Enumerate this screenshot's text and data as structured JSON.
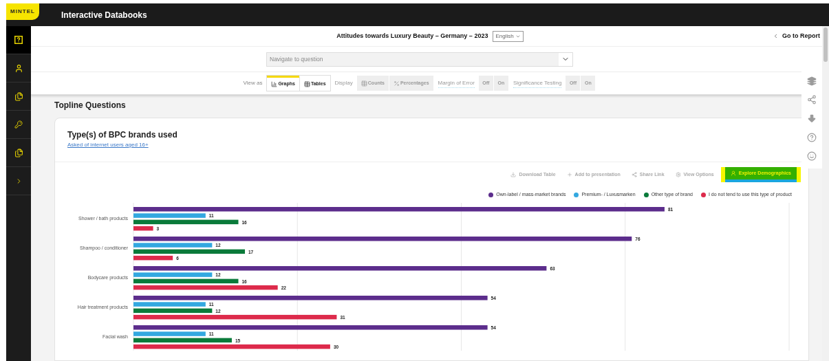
{
  "app": {
    "logo": "MINTEL",
    "title": "Interactive Databooks"
  },
  "sidebar": {
    "items": [
      {
        "kind": "help",
        "selected": true
      },
      {
        "kind": "person",
        "selected": false
      },
      {
        "kind": "files",
        "selected": false
      },
      {
        "kind": "key",
        "selected": false
      },
      {
        "kind": "files",
        "selected": false
      },
      {
        "kind": "expand",
        "selected": false
      }
    ]
  },
  "header": {
    "title": "Attitudes towards Luxury Beauty – Germany – 2023",
    "language": "English",
    "back_link": "Go to Report"
  },
  "navigate": {
    "placeholder": "Navigate to question"
  },
  "toolbar": {
    "view_as_label": "View as",
    "view_tabs": [
      {
        "label": "Graphs",
        "kind": "graphs",
        "selected": true
      },
      {
        "label": "Tables",
        "kind": "tables",
        "selected": false
      }
    ],
    "display": {
      "label": "Display",
      "disabled": true,
      "options": [
        {
          "label": "Counts",
          "kind": "counts"
        },
        {
          "label": "Percentages",
          "kind": "percent"
        }
      ]
    },
    "toggles": [
      {
        "label": "Margin of Error",
        "disabled": true,
        "options": [
          "Off",
          "On"
        ]
      },
      {
        "label": "Significance Testing",
        "disabled": true,
        "options": [
          "Off",
          "On"
        ]
      }
    ]
  },
  "section_title": "Topline Questions",
  "card": {
    "title": "Type(s) of BPC brands used",
    "subtitle_link": "Asked of internet users aged 16+",
    "actions": [
      {
        "label": "Download Table",
        "kind": "download",
        "highlighted": false
      },
      {
        "label": "Add to presentation",
        "kind": "add",
        "highlighted": false
      },
      {
        "label": "Share Link",
        "kind": "share",
        "highlighted": false
      },
      {
        "label": "View Options",
        "kind": "settings",
        "highlighted": false
      },
      {
        "label": "Explore Demographics",
        "kind": "explore",
        "highlighted": true
      }
    ],
    "chart_data": {
      "type": "bar",
      "orientation": "horizontal",
      "categories": [
        "Shower / bath products",
        "Shampoo / conditioner",
        "Bodycare products",
        "Hair treatment products",
        "Facial wash"
      ],
      "xlim": [
        0,
        100
      ],
      "data_labels": true,
      "series": [
        {
          "name": "Own-label / mass-market brands",
          "color": "#5c2d8c",
          "values": [
            81,
            76,
            63,
            54,
            54
          ]
        },
        {
          "name": "Premium- / Luxusmarken",
          "color": "#33a8e0",
          "values": [
            11,
            12,
            12,
            11,
            11
          ]
        },
        {
          "name": "Other type of brand",
          "color": "#0a7a3a",
          "values": [
            16,
            17,
            16,
            12,
            15
          ]
        },
        {
          "name": "I do not tend to use this type of product",
          "color": "#dd2a4b",
          "values": [
            3,
            6,
            22,
            31,
            30
          ]
        }
      ]
    }
  },
  "right_panel": {
    "tools": [
      {
        "kind": "layers"
      },
      {
        "kind": "share"
      },
      {
        "kind": "download"
      },
      {
        "kind": "help"
      },
      {
        "kind": "feedback"
      }
    ]
  }
}
